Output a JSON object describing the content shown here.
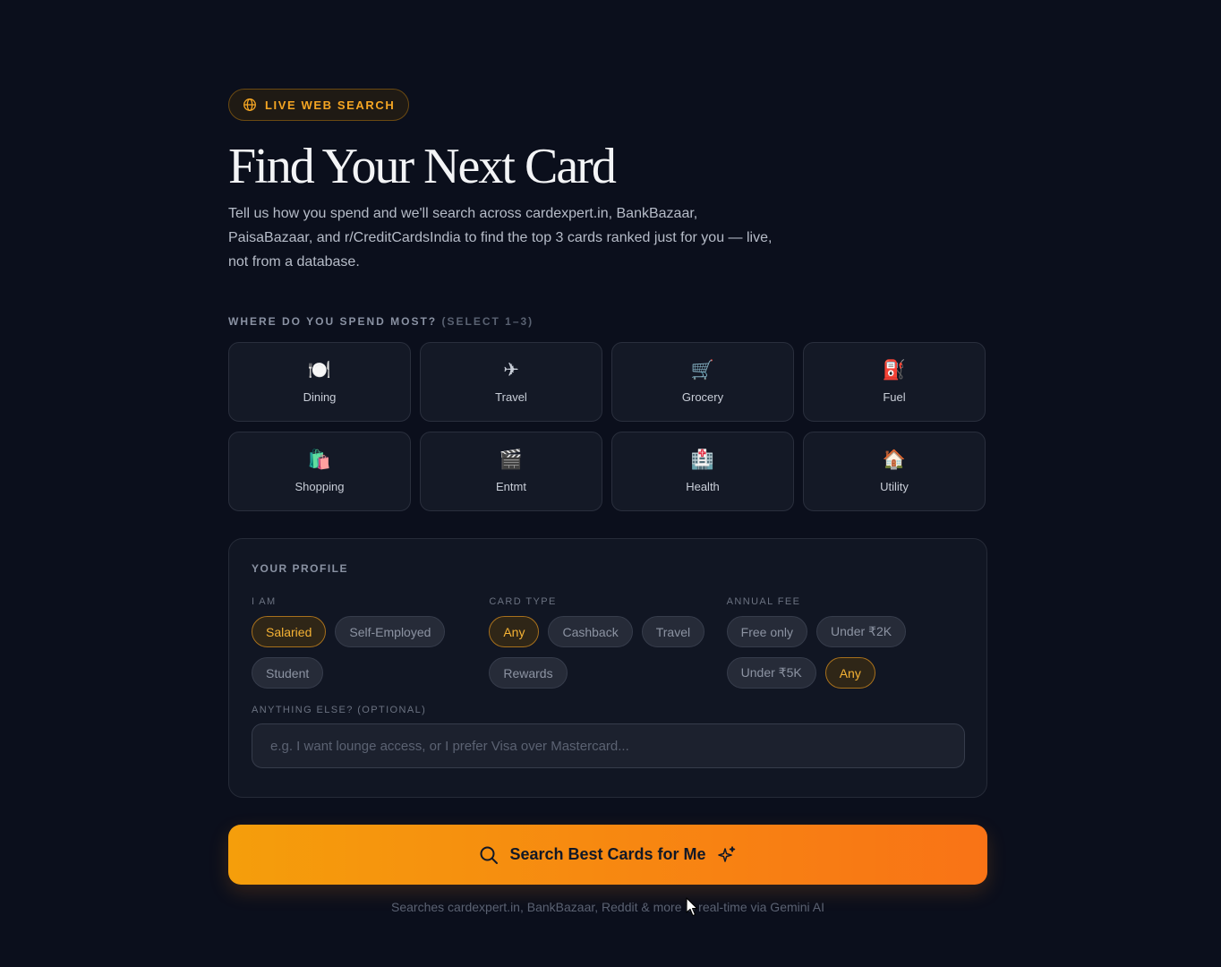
{
  "badge": {
    "icon": "globe-icon",
    "label": "LIVE WEB SEARCH",
    "color": "#f5a623"
  },
  "hero": {
    "title": "Find Your Next Card",
    "subtitle": "Tell us how you spend and we'll search across cardexpert.in, BankBazaar, PaisaBazaar, and r/CreditCardsIndia to find the top 3 cards ranked just for you — live, not from a database."
  },
  "spend": {
    "label": "WHERE DO YOU SPEND MOST?",
    "hint": "(SELECT 1–3)",
    "categories": [
      {
        "emoji": "🍽️",
        "label": "Dining"
      },
      {
        "emoji": "✈",
        "label": "Travel"
      },
      {
        "emoji": "🛒",
        "label": "Grocery"
      },
      {
        "emoji": "⛽",
        "label": "Fuel"
      },
      {
        "emoji": "🛍️",
        "label": "Shopping"
      },
      {
        "emoji": "🎬",
        "label": "Entmt"
      },
      {
        "emoji": "🏥",
        "label": "Health"
      },
      {
        "emoji": "🏠",
        "label": "Utility"
      }
    ]
  },
  "profile": {
    "title": "YOUR PROFILE",
    "i_am": {
      "label": "I AM",
      "options": [
        "Salaried",
        "Self-Employed",
        "Student"
      ],
      "selected": "Salaried"
    },
    "card_type": {
      "label": "CARD TYPE",
      "options": [
        "Any",
        "Cashback",
        "Travel",
        "Rewards"
      ],
      "selected": "Any"
    },
    "annual_fee": {
      "label": "ANNUAL FEE",
      "options": [
        "Free only",
        "Under ₹2K",
        "Under ₹5K",
        "Any"
      ],
      "selected": "Any"
    },
    "extra": {
      "label": "ANYTHING ELSE? (OPTIONAL)",
      "value": "",
      "placeholder": "e.g. I want lounge access, or I prefer Visa over Mastercard..."
    }
  },
  "cta": {
    "label": "Search Best Cards for Me",
    "gradient_start": "#f59e0b",
    "gradient_end": "#f97316"
  },
  "footnote": "Searches cardexpert.in, BankBazaar, Reddit & more in real-time via Gemini AI"
}
